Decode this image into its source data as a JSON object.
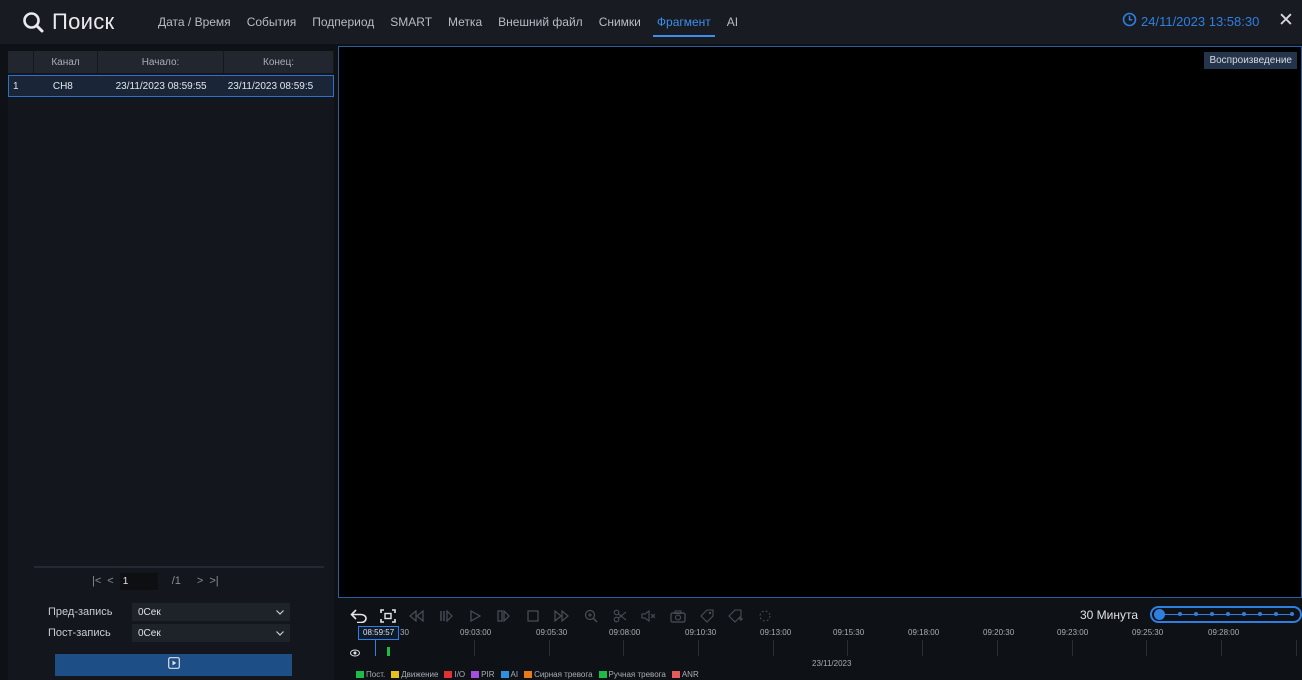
{
  "header": {
    "title": "Поиск",
    "tabs": [
      {
        "label": "Дата / Время",
        "active": false
      },
      {
        "label": "События",
        "active": false
      },
      {
        "label": "Подпериод",
        "active": false
      },
      {
        "label": "SMART",
        "active": false
      },
      {
        "label": "Метка",
        "active": false
      },
      {
        "label": "Внешний файл",
        "active": false
      },
      {
        "label": "Снимки",
        "active": false
      },
      {
        "label": "Фрагмент",
        "active": true
      },
      {
        "label": "AI",
        "active": false
      }
    ],
    "datetime": "24/11/2023 13:58:30",
    "close_glyph": "✕"
  },
  "table": {
    "columns": [
      "Канал",
      "Начало:",
      "Конец:"
    ],
    "rows": [
      {
        "index": "1",
        "channel": "CH8",
        "start": "23/11/2023 08:59:55",
        "end": "23/11/2023 08:59:5"
      }
    ]
  },
  "pager": {
    "first": "|<",
    "prev": "<",
    "current_page": "1",
    "total": "/1",
    "next": ">",
    "last": ">|"
  },
  "settings": {
    "pre_record_label": "Пред-запись",
    "pre_record_value": "0Сек",
    "post_record_label": "Пост-запись",
    "post_record_value": "0Сек"
  },
  "video": {
    "playback_label": "Воспроизведение"
  },
  "controls": {
    "zoom_label": "30 Минута",
    "zoom_level_fraction": 0
  },
  "timeline": {
    "current_time": "08:59:57",
    "tick_labels": [
      "30",
      "09:03:00",
      "09:05:30",
      "09:08:00",
      "09:10:30",
      "09:13:00",
      "09:15:30",
      "09:18:00",
      "09:20:30",
      "09:23:00",
      "09:25:30",
      "09:28:00"
    ],
    "date": "23/11/2023",
    "legend": [
      {
        "label": "Пост.",
        "color": "#1dbb47"
      },
      {
        "label": "Движение",
        "color": "#e5c21c"
      },
      {
        "label": "I/O",
        "color": "#e03232"
      },
      {
        "label": "PIR",
        "color": "#a44ee0"
      },
      {
        "label": "AI",
        "color": "#2f8fe0"
      },
      {
        "label": "Сирная тревога",
        "color": "#e87a1c"
      },
      {
        "label": "Ручная тревога",
        "color": "#1dbb47"
      },
      {
        "label": "ANR",
        "color": "#e55a5a"
      }
    ]
  },
  "colors": {
    "accent": "#2f7fe0",
    "active_tab": "#3d8eeb",
    "selection_border": "#2f73c9"
  }
}
